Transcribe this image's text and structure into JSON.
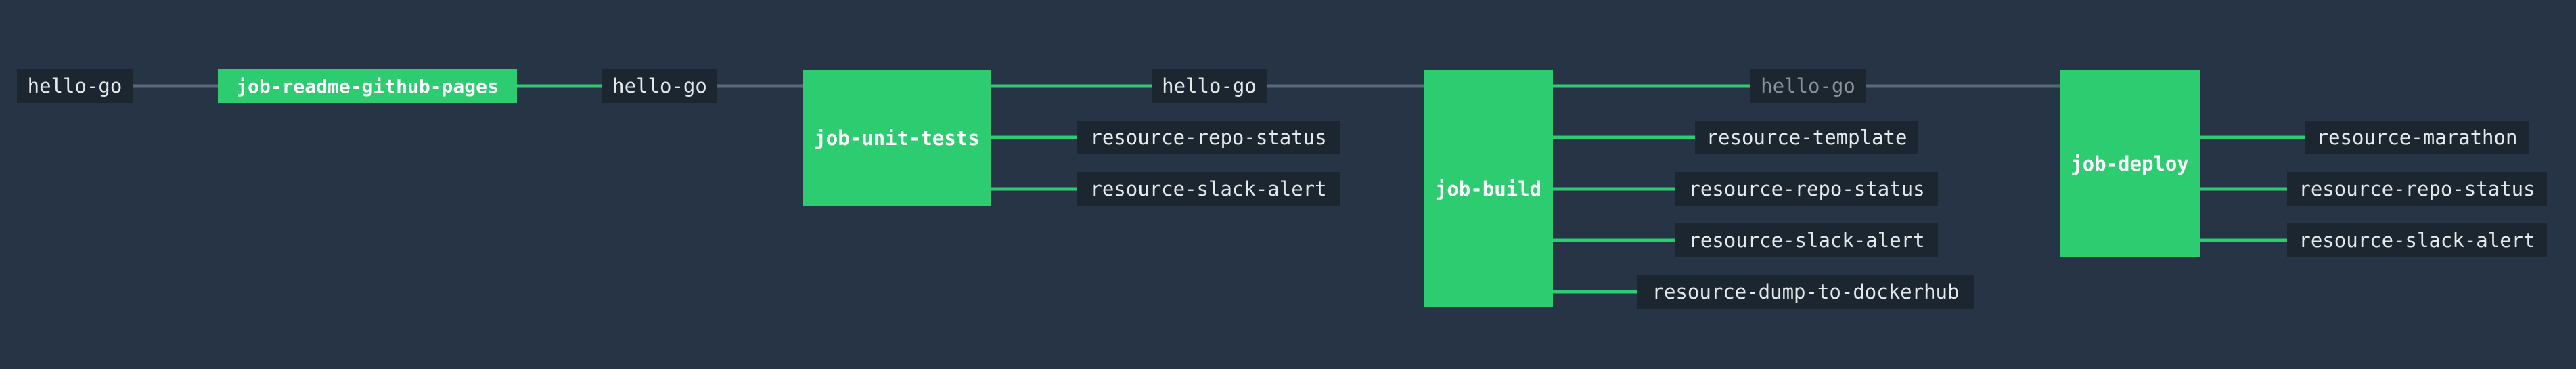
{
  "pipeline": {
    "colors": {
      "background": "#263446",
      "job": "#2ecc71",
      "resource_bg": "#1c2631",
      "edge_active": "#2ecc71",
      "edge_idle": "#5b6878"
    },
    "resources": {
      "hello_go_1": "hello-go",
      "hello_go_2": "hello-go",
      "hello_go_3": "hello-go",
      "hello_go_4": "hello-go",
      "unit_repo_status": "resource-repo-status",
      "unit_slack_alert": "resource-slack-alert",
      "build_template": "resource-template",
      "build_repo_status": "resource-repo-status",
      "build_slack_alert": "resource-slack-alert",
      "build_dump_dockerhub": "resource-dump-to-dockerhub",
      "deploy_marathon": "resource-marathon",
      "deploy_repo_status": "resource-repo-status",
      "deploy_slack_alert": "resource-slack-alert"
    },
    "jobs": {
      "readme": "job-readme-github-pages",
      "unit_tests": "job-unit-tests",
      "build": "job-build",
      "deploy": "job-deploy"
    }
  }
}
